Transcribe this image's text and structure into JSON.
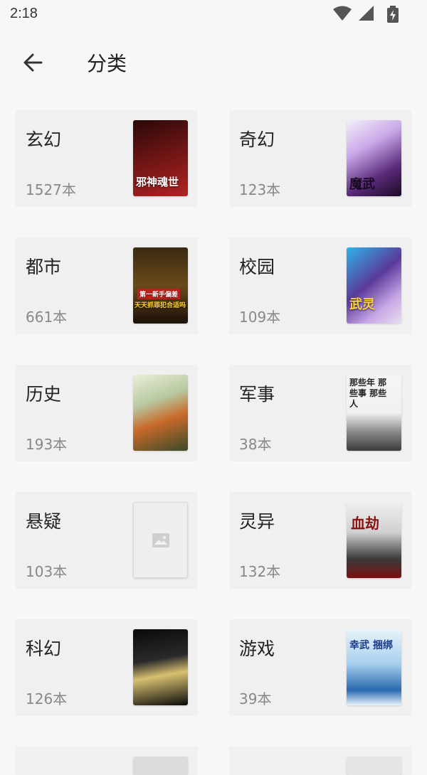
{
  "status_bar": {
    "time": "2:18",
    "icons": [
      "wifi-icon",
      "cell-signal-icon",
      "battery-charging-icon"
    ]
  },
  "header": {
    "title": "分类",
    "back_icon": "arrow-left-icon"
  },
  "categories": [
    {
      "name": "玄幻",
      "count": "1527本",
      "cover": {
        "title": "邪神魂世",
        "colors": [
          "#3a0c0c",
          "#9e1f1f"
        ]
      }
    },
    {
      "name": "奇幻",
      "count": "123本",
      "cover": {
        "title": "魔武",
        "colors": [
          "#2a0f3a",
          "#c7a7e6"
        ]
      }
    },
    {
      "name": "都市",
      "count": "661本",
      "cover": {
        "title": "天天抓罪犯合适吗",
        "banner": "第一新手偏差",
        "colors": [
          "#4a3a1a",
          "#e0b050"
        ]
      }
    },
    {
      "name": "校园",
      "count": "109本",
      "cover": {
        "title": "武灵",
        "colors": [
          "#3a2a6a",
          "#2fb3e8"
        ]
      }
    },
    {
      "name": "历史",
      "count": "193本",
      "cover": {
        "title": "",
        "colors": [
          "#d8e4c8",
          "#c86a2a"
        ]
      }
    },
    {
      "name": "军事",
      "count": "38本",
      "cover": {
        "title": "那些年 那些事 那些人",
        "colors": [
          "#f2f2f2",
          "#555555"
        ]
      }
    },
    {
      "name": "悬疑",
      "count": "103本",
      "cover": {
        "title": "",
        "placeholder": true,
        "colors": [
          "#eeeeee",
          "#dddddd"
        ]
      }
    },
    {
      "name": "灵异",
      "count": "132本",
      "cover": {
        "title": "血劫",
        "colors": [
          "#efefef",
          "#7a1010"
        ]
      }
    },
    {
      "name": "科幻",
      "count": "126本",
      "cover": {
        "title": "",
        "colors": [
          "#0a0a0a",
          "#d8c070"
        ]
      }
    },
    {
      "name": "游戏",
      "count": "39本",
      "cover": {
        "title": "幸武 捆绑",
        "colors": [
          "#cfe6f7",
          "#2a6ab0"
        ]
      }
    }
  ],
  "colors": {
    "background": "#f7f7f7",
    "card": "#f0f0f0",
    "text_primary": "#222222",
    "text_secondary": "#888888"
  }
}
